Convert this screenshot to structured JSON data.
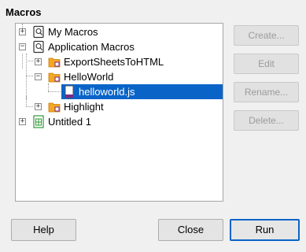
{
  "section": {
    "title": "Macros"
  },
  "tree": {
    "items": [
      {
        "label": "My Macros",
        "expander": "+",
        "icon": "macro-library-icon"
      },
      {
        "label": "Application Macros",
        "expander": "−",
        "icon": "macro-library-icon"
      },
      {
        "label": "ExportSheetsToHTML",
        "expander": "+",
        "icon": "folder-icon"
      },
      {
        "label": "HelloWorld",
        "expander": "−",
        "icon": "folder-icon"
      },
      {
        "label": "helloworld.js",
        "icon": "script-file-icon",
        "selected": true
      },
      {
        "label": "Highlight",
        "expander": "+",
        "icon": "folder-icon"
      },
      {
        "label": "Untitled 1",
        "expander": "+",
        "icon": "spreadsheet-document-icon"
      }
    ]
  },
  "side_buttons": {
    "create": "Create...",
    "edit": "Edit",
    "rename": "Rename...",
    "delete": "Delete..."
  },
  "bottom_buttons": {
    "help": "Help",
    "close": "Close",
    "run": "Run"
  },
  "colors": {
    "selection": "#0a64c8",
    "folder": "#f5a623",
    "script_file": "#7a2a8a",
    "spreadsheet": "#2e9a3a"
  }
}
